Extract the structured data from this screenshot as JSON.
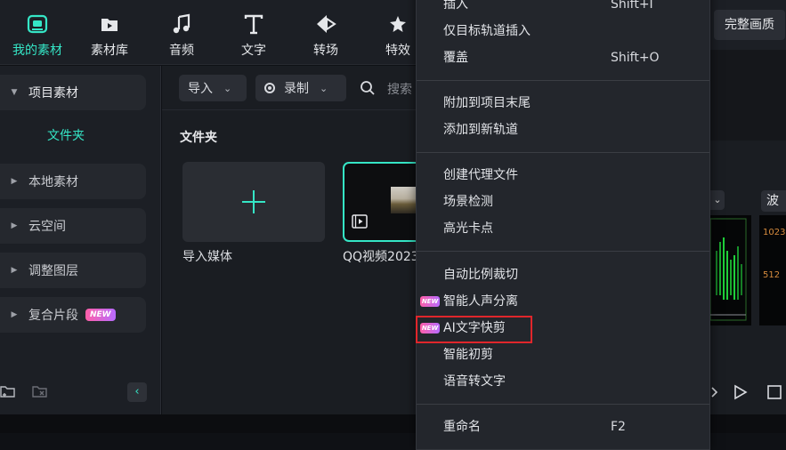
{
  "toolbar": {
    "tabs": [
      {
        "label": "我的素材",
        "icon": "my-media-icon",
        "active": true
      },
      {
        "label": "素材库",
        "icon": "stock-media-icon"
      },
      {
        "label": "音频",
        "icon": "audio-icon"
      },
      {
        "label": "文字",
        "icon": "text-icon"
      },
      {
        "label": "转场",
        "icon": "transition-icon"
      },
      {
        "label": "特效",
        "icon": "effects-icon"
      }
    ],
    "full_quality": "完整画质",
    "accent": "#35e6c6"
  },
  "sidebar": {
    "items": [
      {
        "label": "项目素材",
        "expanded": true
      },
      {
        "label": "本地素材"
      },
      {
        "label": "云空间"
      },
      {
        "label": "调整图层"
      },
      {
        "label": "复合片段",
        "badge": "NEW"
      }
    ],
    "subfolder": "文件夹"
  },
  "media": {
    "import_label": "导入",
    "record_label": "录制",
    "search_placeholder": "搜索",
    "folder_title": "文件夹",
    "import_media_label": "导入媒体",
    "video_label": "QQ视频2023"
  },
  "preview": {
    "scope_tab": "波形",
    "scope_values": [
      "1023",
      "512"
    ]
  },
  "context_menu": {
    "items": [
      {
        "label": "插入",
        "shortcut": "Shift+I"
      },
      {
        "label": "仅目标轨道插入"
      },
      {
        "label": "覆盖",
        "shortcut": "Shift+O"
      },
      {
        "label": "附加到项目末尾"
      },
      {
        "label": "添加到新轨道"
      },
      {
        "label": "创建代理文件"
      },
      {
        "label": "场景检测"
      },
      {
        "label": "高光卡点"
      },
      {
        "label": "自动比例裁切"
      },
      {
        "label": "智能人声分离",
        "badge": "NEW"
      },
      {
        "label": "AI文字快剪",
        "badge": "NEW",
        "highlighted": true
      },
      {
        "label": "智能初剪"
      },
      {
        "label": "语音转文字"
      },
      {
        "label": "重命名",
        "shortcut": "F2"
      }
    ]
  }
}
